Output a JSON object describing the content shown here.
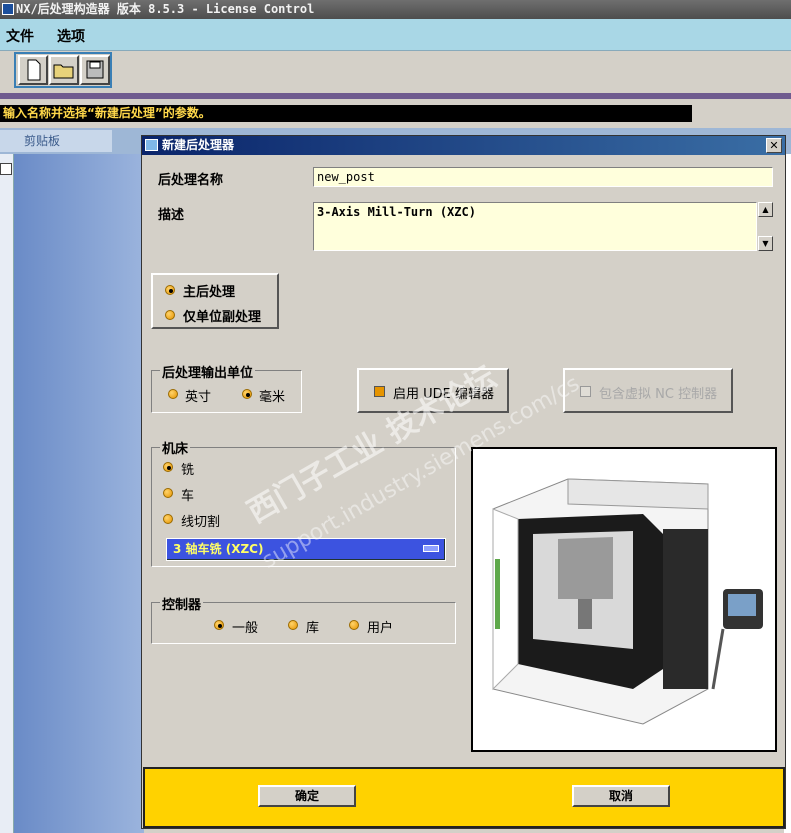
{
  "window": {
    "title": "NX/后处理构造器 版本 8.5.3 - License Control"
  },
  "menu": [
    "文件",
    "选项"
  ],
  "toolbar": {
    "icons": [
      "new-file-icon",
      "open-folder-icon",
      "save-icon"
    ]
  },
  "status": {
    "message": "输入名称并选择“新建后处理”的参数。"
  },
  "side": {
    "clipboard": "剪贴板"
  },
  "dialog": {
    "title": "新建后处理器",
    "close": "✕",
    "name_label": "后处理名称",
    "name_value": "new_post",
    "desc_label": "描述",
    "desc_value": "3-Axis Mill-Turn (XZC)",
    "post_type": [
      "主后处理",
      "仅单位副处理"
    ],
    "units": {
      "legend": "后处理输出单位",
      "options": [
        "英寸",
        "毫米"
      ],
      "selected": "毫米"
    },
    "ude_label": "启用 UDE 编辑器",
    "virtual_nc_label": "包含虚拟 NC 控制器",
    "machine": {
      "legend": "机床",
      "options": [
        "铣",
        "车",
        "线切割"
      ],
      "selected": "铣",
      "dropdown": "3 轴车铣 (XZC)"
    },
    "controller": {
      "legend": "控制器",
      "options": [
        "一般",
        "库",
        "用户"
      ],
      "selected": "一般"
    },
    "ok": "确定",
    "cancel": "取消"
  },
  "watermark": {
    "line1": "西门子工业 技术论坛",
    "line2": "support.industry.siemens.com/cs"
  }
}
